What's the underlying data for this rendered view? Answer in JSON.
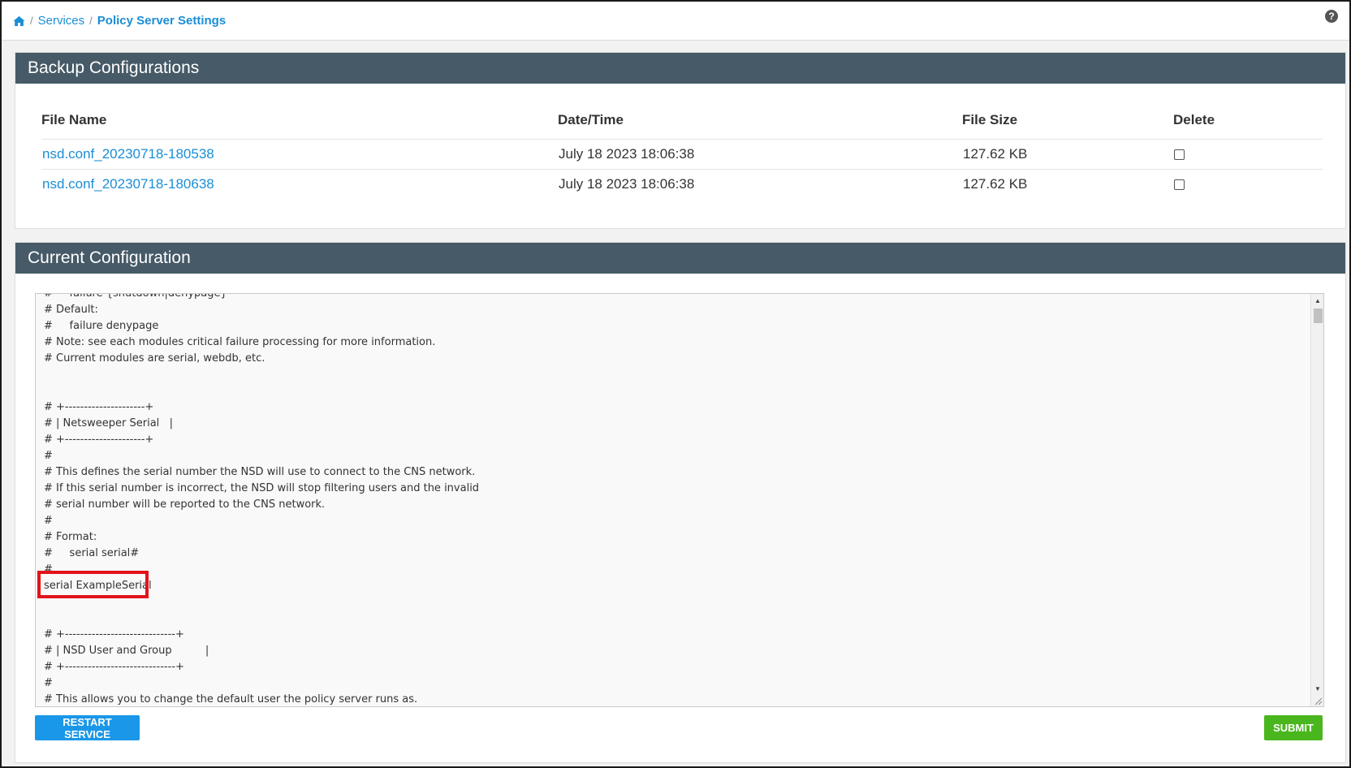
{
  "breadcrumb": {
    "home_icon": "home-icon",
    "items": [
      {
        "label": "Services"
      },
      {
        "label": "Policy Server Settings"
      }
    ],
    "separator": "/",
    "help_icon": "question-circle-icon"
  },
  "backup_panel": {
    "title": "Backup Configurations",
    "columns": [
      "File Name",
      "Date/Time",
      "File Size",
      "Delete"
    ],
    "rows": [
      {
        "file_name": "nsd.conf_20230718-180538",
        "datetime": "July 18 2023 18:06:38",
        "size": "127.62 KB",
        "delete_checked": false
      },
      {
        "file_name": "nsd.conf_20230718-180638",
        "datetime": "July 18 2023 18:06:38",
        "size": "127.62 KB",
        "delete_checked": false
      }
    ]
  },
  "current_panel": {
    "title": "Current Configuration",
    "config_lines": [
      "#     failure {shutdown|denypage}",
      "# Default:",
      "#     failure denypage",
      "# Note: see each modules critical failure processing for more information.",
      "# Current modules are serial, webdb, etc.",
      "",
      "",
      "# +---------------------+",
      "# | Netsweeper Serial   |",
      "# +---------------------+",
      "#",
      "# This defines the serial number the NSD will use to connect to the CNS network.",
      "# If this serial number is incorrect, the NSD will stop filtering users and the invalid",
      "# serial number will be reported to the CNS network.",
      "#",
      "# Format:",
      "#     serial serial#",
      "#",
      "serial ExampleSerial",
      "",
      "",
      "# +-----------------------------+",
      "# | NSD User and Group          |",
      "# +-----------------------------+",
      "#",
      "# This allows you to change the default user the policy server runs as."
    ],
    "highlighted_line": "serial ExampleSerial",
    "highlight_color": "#e2131b",
    "restart_label": "RESTART SERVICE",
    "submit_label": "SUBMIT"
  },
  "colors": {
    "header_bg": "#465a67",
    "link": "#1a8ed6",
    "restart_btn": "#1a97e8",
    "submit_btn": "#4ab61e"
  }
}
